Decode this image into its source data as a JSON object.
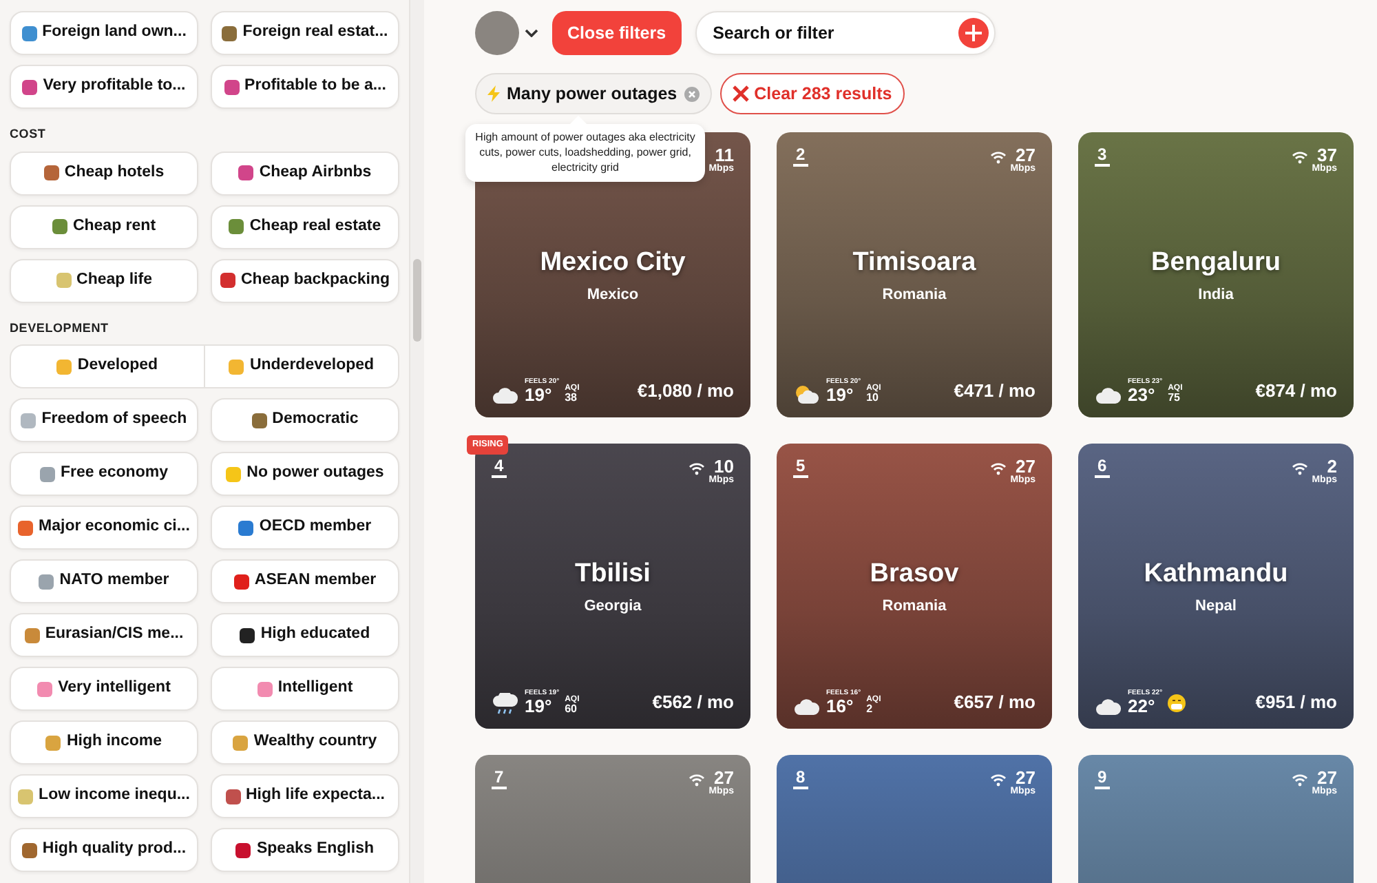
{
  "sidebar": {
    "sections": [
      {
        "rows": [
          {
            "kind": "pair",
            "items": [
              {
                "label": "Foreign land own...",
                "color": "#3f8fd0"
              },
              {
                "label": "Foreign real estat...",
                "color": "#8a6d3b"
              }
            ]
          },
          {
            "kind": "pair",
            "items": [
              {
                "label": "Very profitable to...",
                "color": "#d1458a"
              },
              {
                "label": "Profitable to be a...",
                "color": "#d1458a"
              }
            ]
          }
        ]
      },
      {
        "title": "COST",
        "rows": [
          {
            "kind": "pair",
            "items": [
              {
                "label": "Cheap hotels",
                "color": "#b5653a"
              },
              {
                "label": "Cheap Airbnbs",
                "color": "#d1458a"
              }
            ]
          },
          {
            "kind": "pair",
            "items": [
              {
                "label": "Cheap rent",
                "color": "#6b8e3a"
              },
              {
                "label": "Cheap real estate",
                "color": "#6b8e3a"
              }
            ]
          },
          {
            "kind": "pair",
            "items": [
              {
                "label": "Cheap life",
                "color": "#d8c470"
              },
              {
                "label": "Cheap backpacking",
                "color": "#d32f2f"
              }
            ]
          }
        ]
      },
      {
        "title": "DEVELOPMENT",
        "rows": [
          {
            "kind": "joined",
            "items": [
              {
                "label": "Developed",
                "color": "#f2b632"
              },
              {
                "label": "Underdeveloped",
                "color": "#f2b632"
              }
            ]
          },
          {
            "kind": "pair",
            "items": [
              {
                "label": "Freedom of speech",
                "color": "#b0b8c0"
              },
              {
                "label": "Democratic",
                "color": "#8a6d3b"
              }
            ]
          },
          {
            "kind": "pair",
            "items": [
              {
                "label": "Free economy",
                "color": "#9aa4ad"
              },
              {
                "label": "No power outages",
                "color": "#f5c518"
              }
            ]
          },
          {
            "kind": "pair",
            "items": [
              {
                "label": "Major economic ci...",
                "color": "#e8632c"
              },
              {
                "label": "OECD member",
                "color": "#2a7bd1"
              }
            ]
          },
          {
            "kind": "pair",
            "items": [
              {
                "label": "NATO member",
                "color": "#9aa4ad"
              },
              {
                "label": "ASEAN member",
                "color": "#e0201b"
              }
            ]
          },
          {
            "kind": "pair",
            "items": [
              {
                "label": "Eurasian/CIS me...",
                "color": "#c98a3a"
              },
              {
                "label": "High educated",
                "color": "#222222"
              }
            ]
          },
          {
            "kind": "pair",
            "items": [
              {
                "label": "Very intelligent",
                "color": "#f28bb0"
              },
              {
                "label": "Intelligent",
                "color": "#f28bb0"
              }
            ]
          },
          {
            "kind": "pair",
            "items": [
              {
                "label": "High income",
                "color": "#d9a440"
              },
              {
                "label": "Wealthy country",
                "color": "#d9a440"
              }
            ]
          },
          {
            "kind": "pair",
            "items": [
              {
                "label": "Low income inequ...",
                "color": "#d8c470"
              },
              {
                "label": "High life expecta...",
                "color": "#c0504d"
              }
            ]
          },
          {
            "kind": "pair",
            "items": [
              {
                "label": "High quality prod...",
                "color": "#a0672f"
              },
              {
                "label": "Speaks English",
                "color": "#c8102e"
              }
            ]
          }
        ]
      }
    ]
  },
  "toolbar": {
    "close_filters": "Close filters",
    "search": {
      "placeholder": "Search or filter"
    }
  },
  "active_filters": [
    {
      "label": "Many power outages"
    }
  ],
  "clear_button": "Clear 283 results",
  "tooltip": "High amount of power outages aka electricity cuts, power cuts, loadshedding, power grid, electricity grid",
  "cards": [
    {
      "speed": "11",
      "unit": "Mbps",
      "city": "Mexico City",
      "country": "Mexico",
      "weather": {
        "kind": "cloud"
      },
      "feels": "FEELS 20°",
      "temp": "19°",
      "aqi_label": "AQI",
      "aqi": "38",
      "price": "€1,080 / mo",
      "color": "#7a5a4e"
    },
    {
      "rank": "2",
      "speed": "27",
      "unit": "Mbps",
      "city": "Timisoara",
      "country": "Romania",
      "weather": {
        "kind": "sun"
      },
      "feels": "FEELS 20°",
      "temp": "19°",
      "aqi_label": "AQI",
      "aqi": "10",
      "price": "€471 / mo",
      "color": "#8a7560"
    },
    {
      "rank": "3",
      "speed": "37",
      "unit": "Mbps",
      "city": "Bengaluru",
      "country": "India",
      "weather": {
        "kind": "cloud"
      },
      "feels": "FEELS 23°",
      "temp": "23°",
      "aqi_label": "AQI",
      "aqi": "75",
      "price": "€874 / mo",
      "color": "#6f7a4a"
    },
    {
      "rank": "4",
      "speed": "10",
      "unit": "Mbps",
      "city": "Tbilisi",
      "country": "Georgia",
      "weather": {
        "kind": "rain"
      },
      "feels": "FEELS 19°",
      "temp": "19°",
      "aqi_label": "AQI",
      "aqi": "60",
      "price": "€562 / mo",
      "color": "#4e4a52",
      "badge": "RISING"
    },
    {
      "rank": "5",
      "speed": "27",
      "unit": "Mbps",
      "city": "Brasov",
      "country": "Romania",
      "weather": {
        "kind": "cloud"
      },
      "feels": "FEELS 16°",
      "temp": "16°",
      "aqi_label": "AQI",
      "aqi": "2",
      "price": "€657 / mo",
      "color": "#a0584a"
    },
    {
      "rank": "6",
      "speed": "2",
      "unit": "Mbps",
      "city": "Kathmandu",
      "country": "Nepal",
      "weather": {
        "kind": "cloud"
      },
      "feels": "FEELS 22°",
      "temp": "22°",
      "air_face": true,
      "price": "€951 / mo",
      "color": "#5e6a8a"
    },
    {
      "rank": "7",
      "speed": "27",
      "unit": "Mbps",
      "color": "#8f8c88"
    },
    {
      "rank": "8",
      "speed": "27",
      "unit": "Mbps",
      "color": "#5478b0"
    },
    {
      "rank": "9",
      "speed": "27",
      "unit": "Mbps",
      "color": "#6d8fb0"
    }
  ]
}
